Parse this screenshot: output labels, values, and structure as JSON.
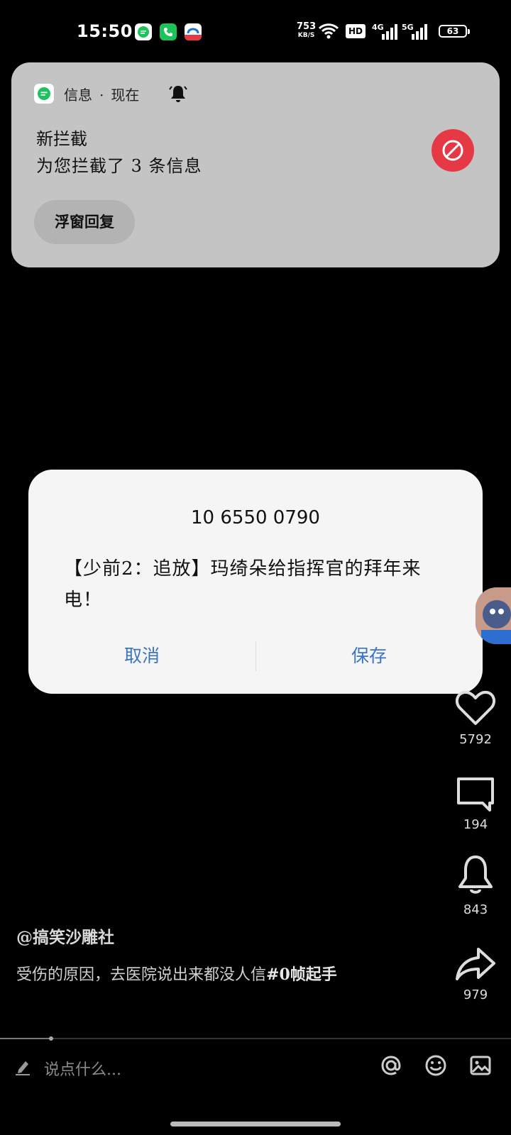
{
  "status_bar": {
    "time": "15:50",
    "net_speed_value": "753",
    "net_speed_unit": "KB/S",
    "hd_label": "HD",
    "signal1_label": "4G",
    "signal2_label": "5G",
    "battery": "63"
  },
  "notification": {
    "app_name": "信息",
    "separator": "·",
    "time": "现在",
    "title": "新拦截",
    "body": "为您拦截了 3 条信息",
    "reply_button": "浮窗回复",
    "accent_color": "#e63946"
  },
  "dialog": {
    "sender": "10 6550 0790",
    "message": "【少前2：追放】玛绮朵给指挥官的拜年来电！",
    "cancel_label": "取消",
    "save_label": "保存",
    "button_color": "#3b74c7"
  },
  "video": {
    "likes": "5792",
    "comments": "194",
    "favorites": "843",
    "shares": "979",
    "author": "@搞笑沙雕社",
    "caption": "受伤的原因，去医院说出来都没人信",
    "hashtag": "#0帧起手",
    "progress": 0.1
  },
  "comment_bar": {
    "placeholder": "说点什么..."
  }
}
